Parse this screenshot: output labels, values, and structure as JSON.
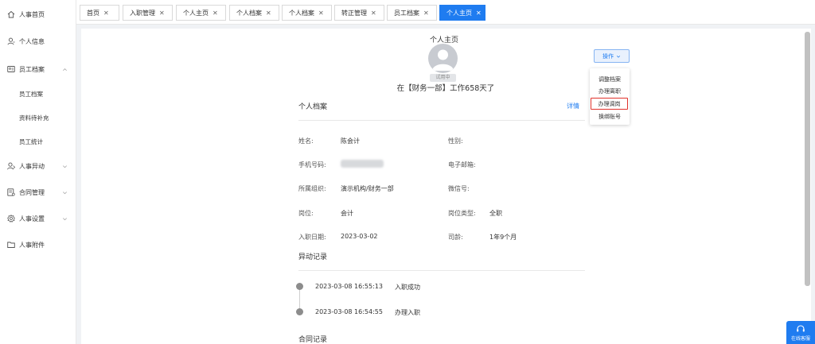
{
  "sidebar": {
    "items": [
      {
        "label": "人事首页"
      },
      {
        "label": "个人信息"
      },
      {
        "label": "员工档案"
      },
      {
        "label": "人事异动"
      },
      {
        "label": "合同管理"
      },
      {
        "label": "人事设置"
      },
      {
        "label": "人事附件"
      }
    ],
    "sub_items": [
      {
        "label": "员工档案"
      },
      {
        "label": "资料待补充"
      },
      {
        "label": "员工统计"
      }
    ]
  },
  "tabs": [
    {
      "label": "首页"
    },
    {
      "label": "入职管理"
    },
    {
      "label": "个人主页"
    },
    {
      "label": "个人档案"
    },
    {
      "label": "个人档案"
    },
    {
      "label": "转正管理"
    },
    {
      "label": "员工档案"
    },
    {
      "label": "个人主页",
      "active": true
    }
  ],
  "profile": {
    "page_title": "个人主页",
    "status": "试用中",
    "work_line": "在【财务一部】工作658天了"
  },
  "actions": {
    "button_label": "操作",
    "menu": [
      "调整档案",
      "办理离职",
      "办理调岗",
      "换绑账号"
    ]
  },
  "archive": {
    "title": "个人档案",
    "detail_link": "详情",
    "fields": [
      {
        "label": "姓名:",
        "value": "陈会计"
      },
      {
        "label": "性别:",
        "value": ""
      },
      {
        "label": "手机号码:",
        "value": ""
      },
      {
        "label": "电子邮箱:",
        "value": ""
      },
      {
        "label": "所属组织:",
        "value": "演示机构/财务一部"
      },
      {
        "label": "微信号:",
        "value": ""
      },
      {
        "label": "岗位:",
        "value": "会计"
      },
      {
        "label": "岗位类型:",
        "value": "全职"
      },
      {
        "label": "入职日期:",
        "value": "2023-03-02"
      },
      {
        "label": "司龄:",
        "value": "1年9个月"
      }
    ]
  },
  "changes": {
    "title": "异动记录",
    "records": [
      {
        "time": "2023-03-08 16:55:13",
        "event": "入职成功"
      },
      {
        "time": "2023-03-08 16:54:55",
        "event": "办理入职"
      }
    ]
  },
  "contracts": {
    "title": "合同记录"
  },
  "support": {
    "label": "在线客服"
  },
  "colors": {
    "accent": "#1f7cf0",
    "highlight_border": "#e0322b"
  }
}
